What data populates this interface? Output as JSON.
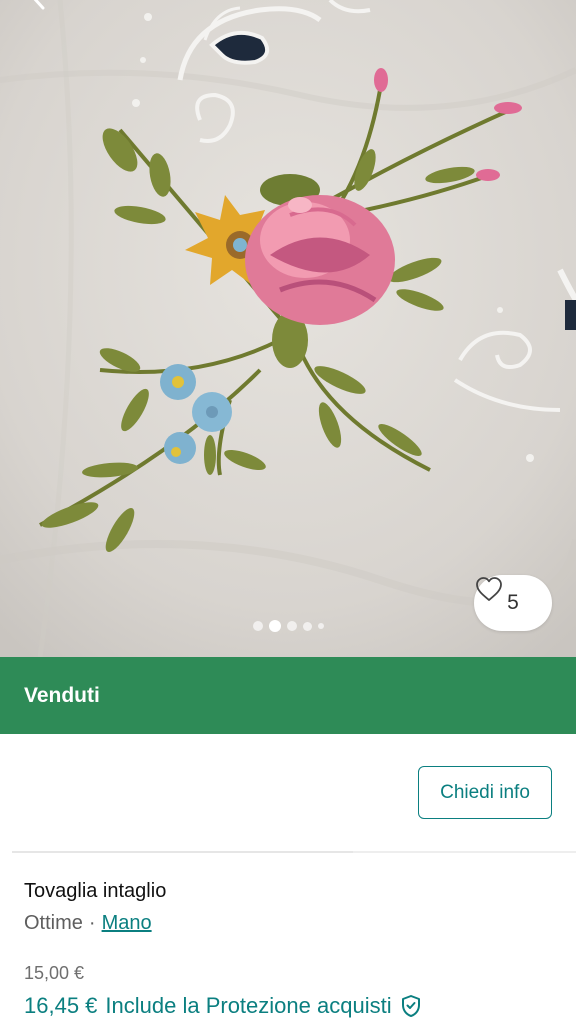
{
  "photo": {
    "dots_count": 5,
    "active_dot": 1
  },
  "favorite": {
    "count": "5",
    "icon": "heart-outline-icon"
  },
  "banner": {
    "label": "Venduti",
    "color": "#2e8b57"
  },
  "actions": {
    "ask_info": "Chiedi info"
  },
  "item": {
    "title": "Tovaglia intaglio",
    "condition": "Ottime",
    "separator": "·",
    "brand": "Mano",
    "price": "15,00 €",
    "price_with_protection": "16,45 €",
    "protection_label": "Include la Protezione acquisti"
  },
  "colors": {
    "accent": "#0b7f80",
    "banner": "#2e8b57"
  }
}
